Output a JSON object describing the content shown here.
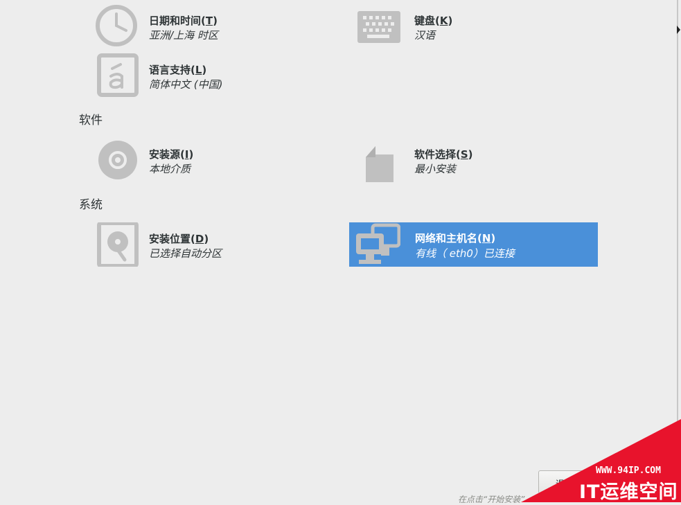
{
  "sections": {
    "localization_tail": {
      "datetime": {
        "title": "日期和时间(",
        "mnemonic": "T",
        "title_end": ")",
        "status": "亚洲/上海 时区",
        "icon": "clock-icon"
      },
      "keyboard": {
        "title": "键盘(",
        "mnemonic": "K",
        "title_end": ")",
        "status": "汉语",
        "icon": "keyboard-icon"
      },
      "language": {
        "title": "语言支持(",
        "mnemonic": "L",
        "title_end": ")",
        "status": "简体中文 (中国)",
        "icon": "language-icon"
      }
    },
    "software": {
      "header": "软件",
      "source": {
        "title": "安装源(",
        "mnemonic": "I",
        "title_end": ")",
        "status": "本地介质",
        "icon": "disc-icon"
      },
      "selection": {
        "title": "软件选择(",
        "mnemonic": "S",
        "title_end": ")",
        "status": "最小安装",
        "icon": "package-icon"
      }
    },
    "system": {
      "header": "系统",
      "destination": {
        "title": "安装位置(",
        "mnemonic": "D",
        "title_end": ")",
        "status": "已选择自动分区",
        "icon": "harddisk-icon"
      },
      "network": {
        "title": "网络和主机名(",
        "mnemonic": "N",
        "title_end": ")",
        "status": "有线（ eth0）已连接",
        "icon": "network-icon"
      }
    }
  },
  "footer": {
    "quit_label": "退出",
    "hint": "在点击“开始安装”"
  },
  "watermark": {
    "url": "WWW.94IP.COM",
    "brand": "IT运维空间"
  },
  "colors": {
    "background": "#ededed",
    "icon": "#c0c0c0",
    "selected": "#4a90d9",
    "watermark": "#e8132c"
  }
}
